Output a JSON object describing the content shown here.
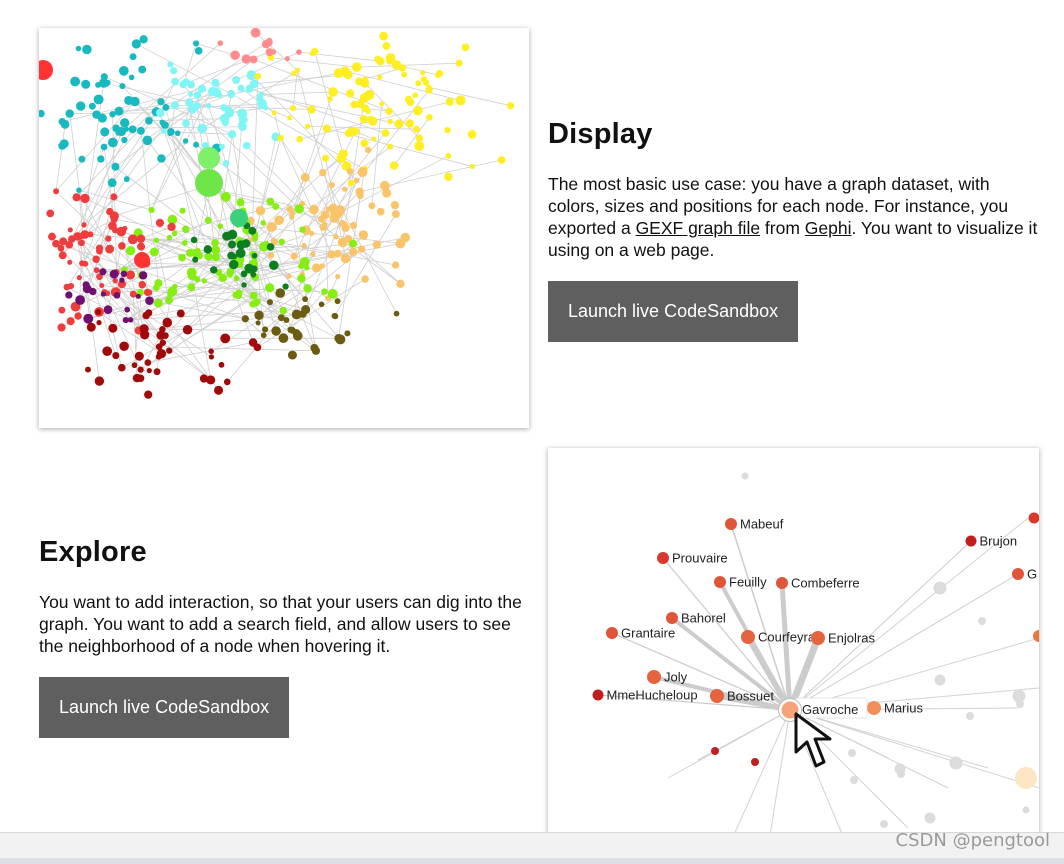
{
  "display": {
    "title": "Display",
    "body_before_link1": "The most basic use case: you have a graph dataset, with colors, sizes and positions for each node. For instance, you exported a ",
    "link1": "GEXF graph file",
    "body_between": " from ",
    "link2": "Gephi",
    "body_after": ". You want to visualize it using on a web page.",
    "button_label": "Launch live CodeSandbox"
  },
  "explore": {
    "title": "Explore",
    "body": "You want to add interaction, so that your users can dig into the graph. You want to add a search field, and allow users to see the neighborhood of a node when hovering it.",
    "button_label": "Launch live CodeSandbox",
    "graph": {
      "hovered": "Gavroche",
      "neighbors": [
        "Mabeuf",
        "Prouvaire",
        "Feuilly",
        "Combeferre",
        "Bahorel",
        "Grantaire",
        "Courfeyrac",
        "Enjolras",
        "Joly",
        "MmeHucheloup",
        "Bossuet",
        "Marius",
        "Brujon",
        "G"
      ]
    }
  },
  "colors": {
    "button_bg": "#5f5f5f",
    "node_red": "#e0553a",
    "node_darkred": "#c21e1e",
    "hover_node": "#f6a37a",
    "edge_gray": "#cccccc"
  },
  "watermark": "CSDN @pengtool"
}
